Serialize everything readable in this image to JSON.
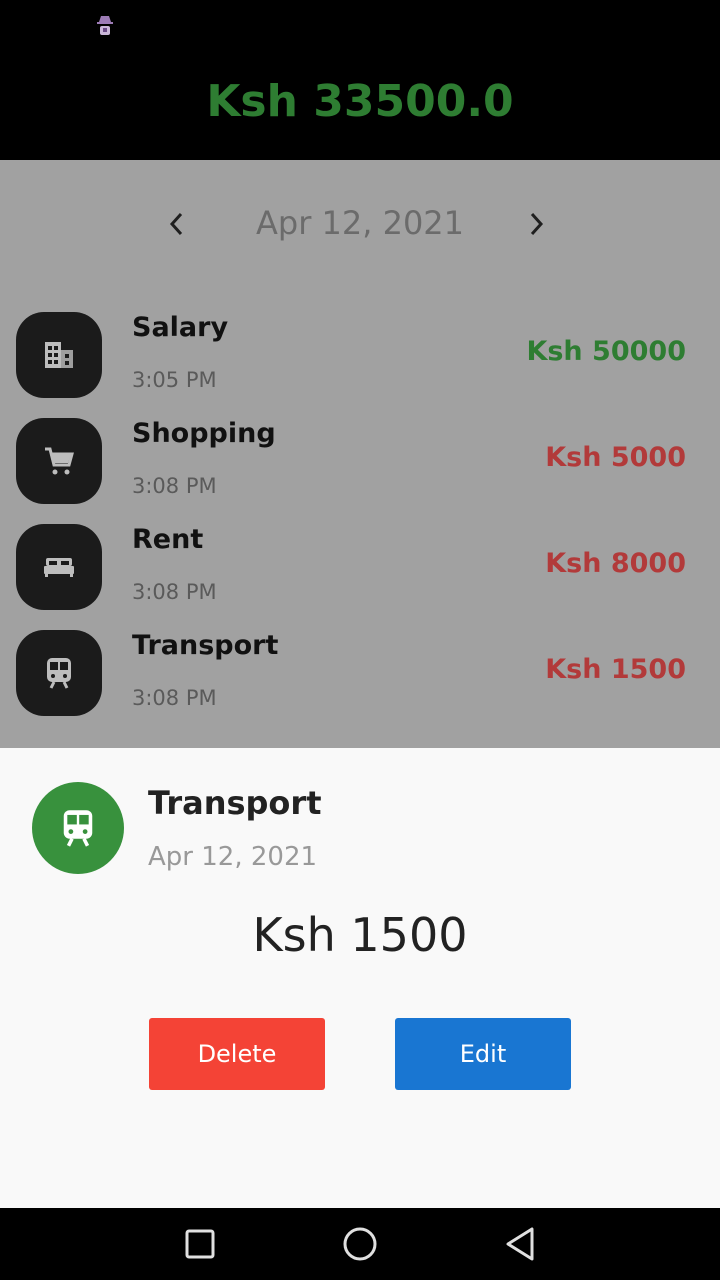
{
  "status_bar": {
    "notification_icon": "incognito-icon"
  },
  "header": {
    "balance": "Ksh 33500.0",
    "balance_color": "#2e7d32"
  },
  "date_nav": {
    "date": "Apr 12, 2021",
    "prev_icon": "chevron-left-icon",
    "next_icon": "chevron-right-icon"
  },
  "transactions": [
    {
      "name": "Salary",
      "time": "3:05 PM",
      "amount": "Ksh 50000",
      "type": "income",
      "icon": "building-icon"
    },
    {
      "name": "Shopping",
      "time": "3:08 PM",
      "amount": "Ksh 5000",
      "type": "expense",
      "icon": "cart-icon"
    },
    {
      "name": "Rent",
      "time": "3:08 PM",
      "amount": "Ksh 8000",
      "type": "expense",
      "icon": "bed-icon"
    },
    {
      "name": "Transport",
      "time": "3:08 PM",
      "amount": "Ksh 1500",
      "type": "expense",
      "icon": "train-icon"
    }
  ],
  "detail_sheet": {
    "title": "Transport",
    "date": "Apr 12, 2021",
    "amount": "Ksh 1500",
    "icon": "train-icon",
    "icon_bg": "#38913d",
    "delete_label": "Delete",
    "edit_label": "Edit",
    "delete_color": "#f44336",
    "edit_color": "#1976d2"
  },
  "nav_bar": {
    "recents_icon": "square-icon",
    "home_icon": "circle-icon",
    "back_icon": "triangle-back-icon"
  }
}
